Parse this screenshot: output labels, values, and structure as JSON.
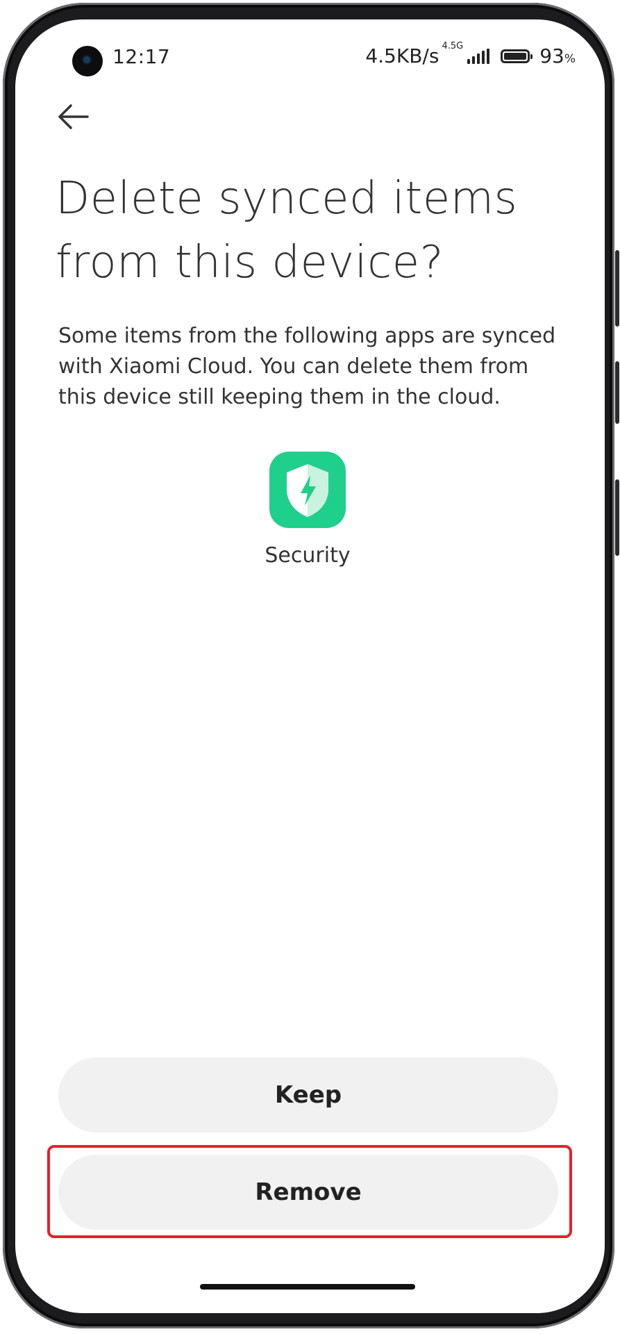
{
  "status_bar": {
    "time": "12:17",
    "net_speed": "4.5KB/s",
    "net_type": "4.5G",
    "battery_value": "93",
    "battery_unit": "%",
    "signal_bars": 4,
    "battery_level": 0.93
  },
  "header": {
    "back_icon": "arrow-left-icon",
    "title": "Delete synced items from this device?"
  },
  "main": {
    "description": "Some items from the following apps are synced with Xiaomi Cloud. You can delete them from this device still keeping them in the cloud.",
    "apps": [
      {
        "label": "Security",
        "icon": "security-shield-icon",
        "color": "#1fcf8c"
      }
    ]
  },
  "actions": {
    "keep_label": "Keep",
    "remove_label": "Remove",
    "highlight_color": "#e8202b"
  }
}
